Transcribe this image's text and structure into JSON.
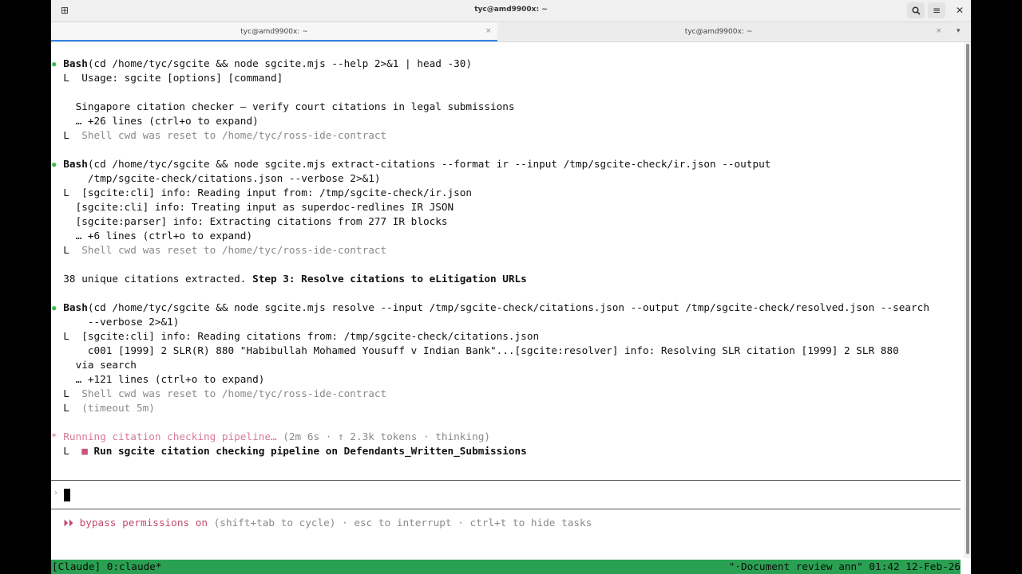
{
  "window": {
    "title": "tyc@amd9900x: ~",
    "tabs": [
      {
        "label": "tyc@amd9900x: ~",
        "close": "×"
      },
      {
        "label": "tyc@amd9900x: ~",
        "close": "×"
      }
    ],
    "icons": {
      "new_tab": "new-tab-icon",
      "search": "search-icon",
      "menu": "hamburger-menu-icon",
      "close": "close-icon",
      "tab_menu": "chevron-down-icon"
    },
    "glyphs": {
      "new_tab": "⊞",
      "search": "🔍",
      "menu": "≡",
      "close": "✕",
      "tab_menu": "▾"
    }
  },
  "terminal": {
    "block1": {
      "tool": "Bash",
      "command": "(cd /home/tyc/sgcite && node sgcite.mjs --help 2>&1 | head -30)",
      "out1": "Usage: sgcite [options] [command]",
      "out2": "Singapore citation checker — verify court citations in legal submissions",
      "out3": "… +26 lines (ctrl+o to expand)",
      "reset": "Shell cwd was reset to /home/tyc/ross-ide-contract"
    },
    "block2": {
      "tool": "Bash",
      "command": "(cd /home/tyc/sgcite && node sgcite.mjs extract-citations --format ir --input /tmp/sgcite-check/ir.json --output",
      "command_cont": "/tmp/sgcite-check/citations.json --verbose 2>&1)",
      "out1": "[sgcite:cli] info: Reading input from: /tmp/sgcite-check/ir.json",
      "out2": "[sgcite:cli] info: Treating input as superdoc-redlines IR JSON",
      "out3": "[sgcite:parser] info: Extracting citations from 277 IR blocks",
      "out4": "… +6 lines (ctrl+o to expand)",
      "reset": "Shell cwd was reset to /home/tyc/ross-ide-contract"
    },
    "message": {
      "plain": "38 unique citations extracted. ",
      "bold": "Step 3: Resolve citations to eLitigation URLs"
    },
    "block3": {
      "tool": "Bash",
      "command": "(cd /home/tyc/sgcite && node sgcite.mjs resolve --input /tmp/sgcite-check/citations.json --output /tmp/sgcite-check/resolved.json --search",
      "command_cont": "--verbose 2>&1)",
      "out1": "[sgcite:cli] info: Reading citations from: /tmp/sgcite-check/citations.json",
      "out2": "c001 [1999] 2 SLR(R) 880 \"Habibullah Mohamed Yousuff v Indian Bank\"...[sgcite:resolver] info: Resolving SLR citation [1999] 2 SLR 880",
      "out3": "via search",
      "out4": "… +121 lines (ctrl+o to expand)",
      "reset": "Shell cwd was reset to /home/tyc/ross-ide-contract",
      "timeout": "(timeout 5m)"
    },
    "running": {
      "spinner": "*",
      "label": "Running citation checking pipeline…",
      "meta": " (2m 6s · ↑ 2.3k tokens · thinking)",
      "task": "Run sgcite citation checking pipeline on Defendants_Written_Submissions"
    },
    "corner": "L",
    "bullet": "●",
    "task_square": "■",
    "prompt_chevron": "›",
    "hint": {
      "arrows": "⏵⏵ ",
      "mode": "bypass permissions on",
      "rest": " (shift+tab to cycle) · esc to interrupt · ctrl+t to hide tasks"
    }
  },
  "statusbar": {
    "left": "[Claude] 0:claude*",
    "right": "\"·Document review ann\" 01:42 12-Feb-26"
  },
  "colors": {
    "accent_tab": "#3584e4",
    "bullet_green": "#3fb950",
    "status_green": "#2aa152",
    "pink": "#c04a6b"
  }
}
